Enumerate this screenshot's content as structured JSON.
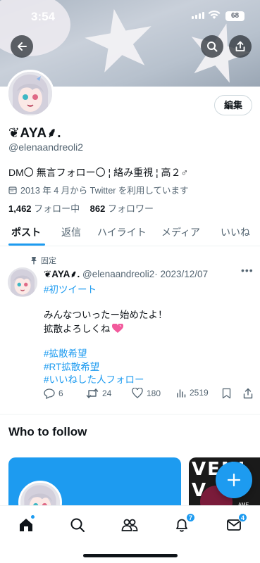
{
  "status_bar": {
    "time": "3:54",
    "battery": "68"
  },
  "header": {
    "back_icon": "back-arrow-icon",
    "search_icon": "search-icon",
    "share_icon": "share-icon"
  },
  "profile": {
    "edit_label": "編集",
    "display_name": "❦AYA⸙.",
    "handle": "@elenaandreoli2",
    "bio": "DM〇 無言フォロー〇 ¦ 絡み重視 ¦ 高２♂",
    "joined": "2013 年 4 月から Twitter を利用しています",
    "following_count": "1,462",
    "following_label": "フォロー中",
    "followers_count": "862",
    "followers_label": "フォロワー"
  },
  "tabs": [
    {
      "label": "ポスト",
      "active": true
    },
    {
      "label": "返信",
      "active": false
    },
    {
      "label": "ハイライト",
      "active": false
    },
    {
      "label": "メディア",
      "active": false
    },
    {
      "label": "いいね",
      "active": false
    }
  ],
  "tweet": {
    "pinned_label": "固定",
    "author_name": "❦AYA⸙.",
    "author_handle": "@elenaandreoli2",
    "date": "· 2023/12/07",
    "lines": [
      {
        "text": "#初ツイート",
        "link": true
      },
      {
        "text": "みんなついったー始めたよ！",
        "link": false
      },
      {
        "text": "拡散よろしくね",
        "link": false
      },
      {
        "text": "#拡散希望",
        "link": true
      },
      {
        "text": "#RT拡散希望",
        "link": true
      },
      {
        "text": "#いいねした人フォロー",
        "link": true
      }
    ],
    "emoji": "heart-emoji",
    "replies": "6",
    "retweets": "24",
    "likes": "180",
    "views": "2519"
  },
  "who_to_follow": {
    "title": "Who to follow",
    "card2_text": "VENI V",
    "card2_caption": "AME"
  },
  "bottom_nav": {
    "notifications_badge": "7",
    "messages_badge": "4"
  },
  "colors": {
    "accent": "#1d9bf0",
    "text": "#0f1419",
    "muted": "#536471"
  }
}
